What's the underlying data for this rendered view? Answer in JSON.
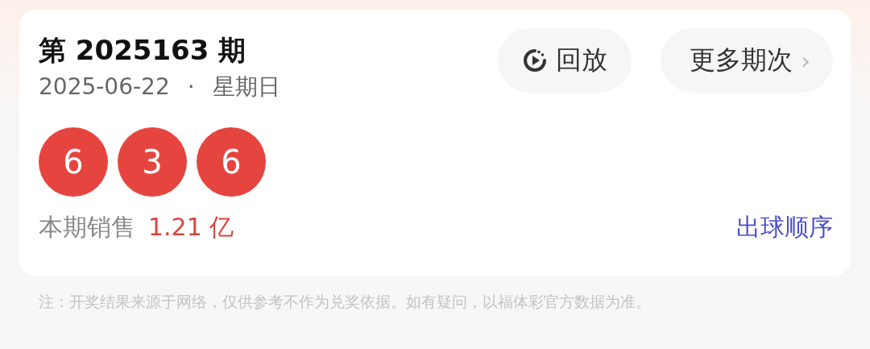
{
  "draw": {
    "title": "第 2025163 期",
    "date": "2025-06-22",
    "separator": "·",
    "weekday": "星期日"
  },
  "buttons": [
    {
      "kind": "replay",
      "label": "回放"
    },
    {
      "kind": "more",
      "label": "更多期次",
      "chevron": "›"
    }
  ],
  "balls": [
    "6",
    "3",
    "6"
  ],
  "sales": {
    "label": "本期销售",
    "amount": "1.21 亿"
  },
  "order_link": "出球顺序",
  "note": "注：开奖结果来源于网络，仅供参考不作为兑奖依据。如有疑问，以福体彩官方数据为准。"
}
